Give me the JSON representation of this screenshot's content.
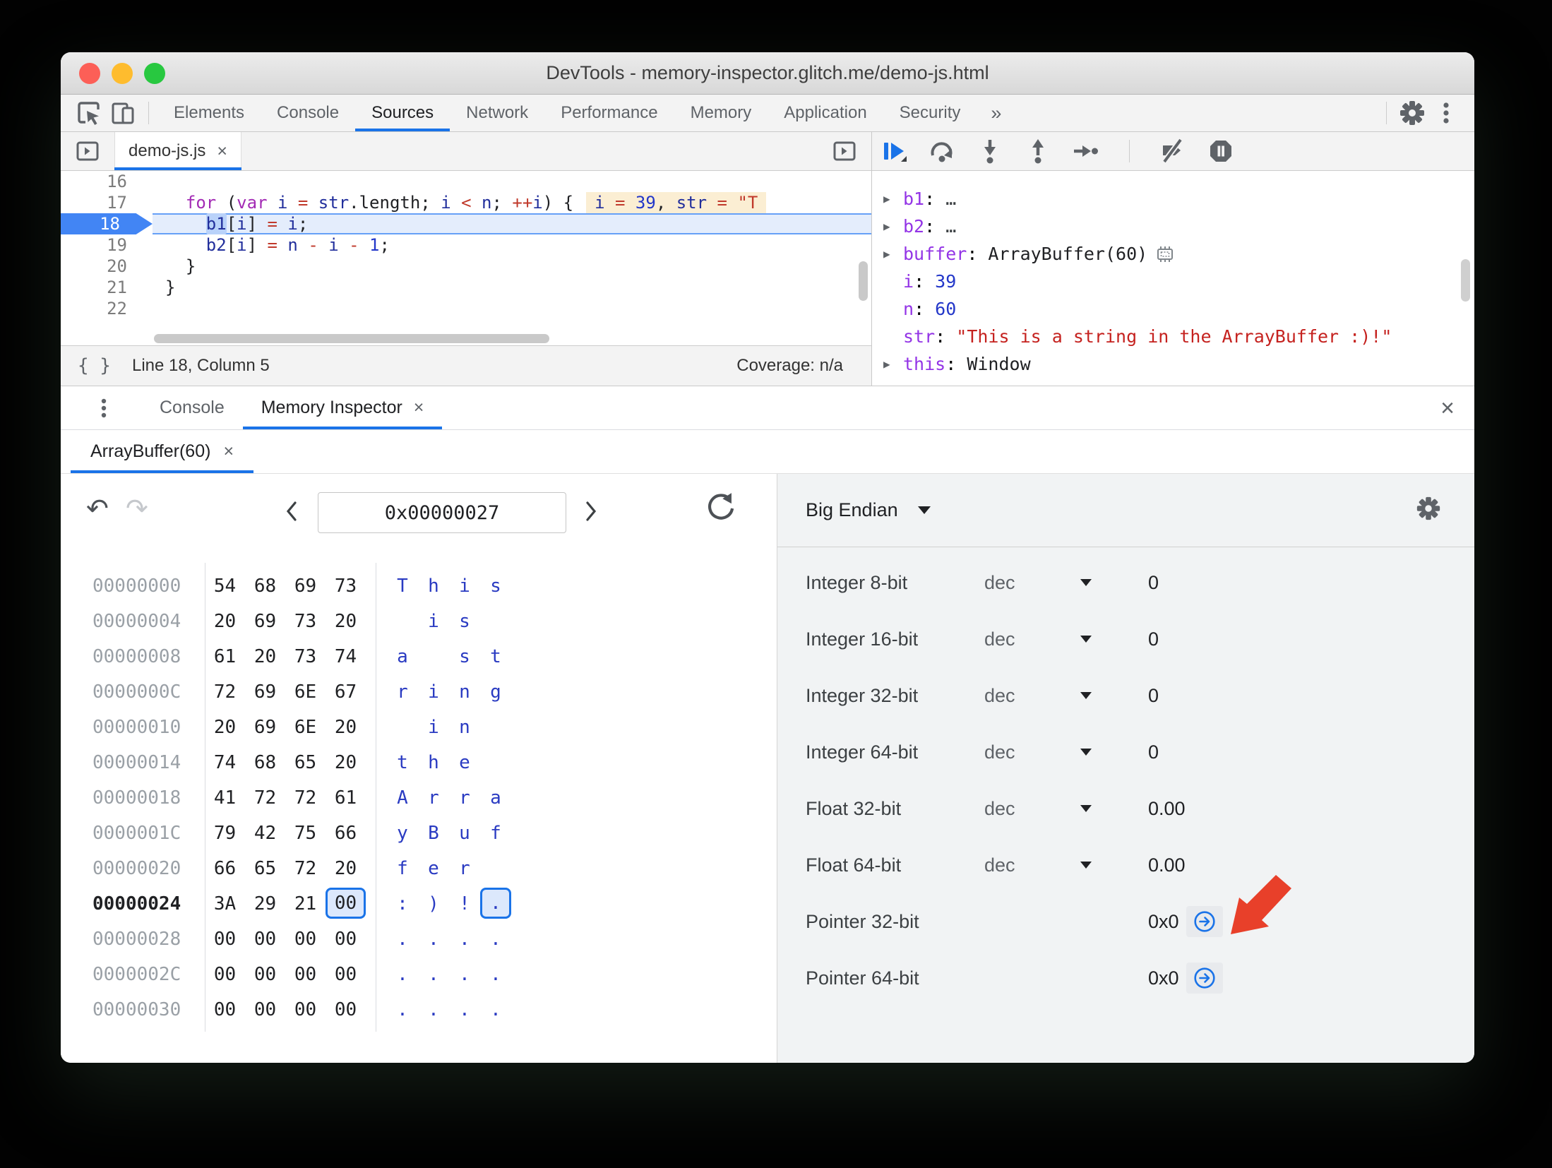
{
  "window": {
    "title": "DevTools - memory-inspector.glitch.me/demo-js.html"
  },
  "toolbar": {
    "tabs": [
      "Elements",
      "Console",
      "Sources",
      "Network",
      "Performance",
      "Memory",
      "Application",
      "Security"
    ],
    "active_tab": "Sources",
    "overflow": "»"
  },
  "sources": {
    "file_tab": {
      "label": "demo-js.js",
      "close": "×"
    },
    "code": {
      "lines": [
        {
          "num": "16",
          "tokens": []
        },
        {
          "num": "17",
          "tokens": [
            [
              "pl",
              "  "
            ],
            [
              "kw",
              "for"
            ],
            [
              "pl",
              " ("
            ],
            [
              "kw",
              "var"
            ],
            [
              "pl",
              " "
            ],
            [
              "v",
              "i"
            ],
            [
              "pl",
              " "
            ],
            [
              "op",
              "="
            ],
            [
              "pl",
              " "
            ],
            [
              "v",
              "str"
            ],
            [
              "pl",
              ".length; "
            ],
            [
              "v",
              "i"
            ],
            [
              "pl",
              " "
            ],
            [
              "op",
              "<"
            ],
            [
              "pl",
              " "
            ],
            [
              "v",
              "n"
            ],
            [
              "pl",
              "; "
            ],
            [
              "op",
              "++"
            ],
            [
              "v",
              "i"
            ],
            [
              "pl",
              ") {"
            ]
          ],
          "eval": [
            [
              "v",
              "i"
            ],
            [
              "pl",
              " "
            ],
            [
              "op",
              "="
            ],
            [
              "pl",
              " "
            ],
            [
              "num",
              "39"
            ],
            [
              "pl",
              ", "
            ],
            [
              "v",
              "str"
            ],
            [
              "pl",
              " "
            ],
            [
              "op",
              "="
            ],
            [
              "pl",
              " "
            ],
            [
              "str",
              "\"T"
            ]
          ]
        },
        {
          "num": "18",
          "exec": true,
          "tokens": [
            [
              "pl",
              "    "
            ],
            [
              "vh",
              "b1"
            ],
            [
              "pl",
              "["
            ],
            [
              "v",
              "i"
            ],
            [
              "pl",
              "] "
            ],
            [
              "op",
              "="
            ],
            [
              "pl",
              " "
            ],
            [
              "v",
              "i"
            ],
            [
              "pl",
              ";"
            ]
          ]
        },
        {
          "num": "19",
          "tokens": [
            [
              "pl",
              "    "
            ],
            [
              "v",
              "b2"
            ],
            [
              "pl",
              "["
            ],
            [
              "v",
              "i"
            ],
            [
              "pl",
              "] "
            ],
            [
              "op",
              "="
            ],
            [
              "pl",
              " "
            ],
            [
              "v",
              "n"
            ],
            [
              "pl",
              " "
            ],
            [
              "op",
              "-"
            ],
            [
              "pl",
              " "
            ],
            [
              "v",
              "i"
            ],
            [
              "pl",
              " "
            ],
            [
              "op",
              "-"
            ],
            [
              "pl",
              " "
            ],
            [
              "num",
              "1"
            ],
            [
              "pl",
              ";"
            ]
          ]
        },
        {
          "num": "20",
          "tokens": [
            [
              "pl",
              "  }"
            ]
          ]
        },
        {
          "num": "21",
          "tokens": [
            [
              "pl",
              "}"
            ]
          ]
        },
        {
          "num": "22",
          "tokens": []
        }
      ]
    }
  },
  "status": {
    "braces": "{ }",
    "position": "Line 18, Column 5",
    "coverage": "Coverage: n/a"
  },
  "debugger": {
    "scope": [
      {
        "expand": true,
        "name": "b1",
        "value": "…",
        "vclass": "dim"
      },
      {
        "expand": true,
        "name": "b2",
        "value": "…",
        "vclass": "dim"
      },
      {
        "expand": true,
        "name": "buffer",
        "value": "ArrayBuffer(60)",
        "vclass": "obj",
        "icon": "memory-chip"
      },
      {
        "expand": false,
        "name": "i",
        "value": "39",
        "vclass": "num"
      },
      {
        "expand": false,
        "name": "n",
        "value": "60",
        "vclass": "num"
      },
      {
        "expand": false,
        "name": "str",
        "value": "\"This is a string in the ArrayBuffer :)!\"",
        "vclass": "str"
      },
      {
        "expand": true,
        "name": "this",
        "value": "Window",
        "vclass": "obj"
      }
    ]
  },
  "drawer": {
    "tabs": [
      {
        "label": "Console",
        "active": false
      },
      {
        "label": "Memory Inspector",
        "active": true,
        "close": "×"
      }
    ],
    "close": "×"
  },
  "memory": {
    "tab": {
      "label": "ArrayBuffer(60)",
      "close": "×"
    },
    "address": "0x00000027",
    "endianness": "Big Endian",
    "hex_rows": [
      {
        "addr": "00000000",
        "bytes": [
          "54",
          "68",
          "69",
          "73"
        ],
        "ascii": [
          "T",
          "h",
          "i",
          "s"
        ]
      },
      {
        "addr": "00000004",
        "bytes": [
          "20",
          "69",
          "73",
          "20"
        ],
        "ascii": [
          " ",
          "i",
          "s",
          " "
        ]
      },
      {
        "addr": "00000008",
        "bytes": [
          "61",
          "20",
          "73",
          "74"
        ],
        "ascii": [
          "a",
          " ",
          "s",
          "t"
        ]
      },
      {
        "addr": "0000000C",
        "bytes": [
          "72",
          "69",
          "6E",
          "67"
        ],
        "ascii": [
          "r",
          "i",
          "n",
          "g"
        ]
      },
      {
        "addr": "00000010",
        "bytes": [
          "20",
          "69",
          "6E",
          "20"
        ],
        "ascii": [
          " ",
          "i",
          "n",
          " "
        ]
      },
      {
        "addr": "00000014",
        "bytes": [
          "74",
          "68",
          "65",
          "20"
        ],
        "ascii": [
          "t",
          "h",
          "e",
          " "
        ]
      },
      {
        "addr": "00000018",
        "bytes": [
          "41",
          "72",
          "72",
          "61"
        ],
        "ascii": [
          "A",
          "r",
          "r",
          "a"
        ]
      },
      {
        "addr": "0000001C",
        "bytes": [
          "79",
          "42",
          "75",
          "66"
        ],
        "ascii": [
          "y",
          "B",
          "u",
          "f"
        ]
      },
      {
        "addr": "00000020",
        "bytes": [
          "66",
          "65",
          "72",
          "20"
        ],
        "ascii": [
          "f",
          "e",
          "r",
          " "
        ]
      },
      {
        "addr": "00000024",
        "bytes": [
          "3A",
          "29",
          "21",
          "00"
        ],
        "ascii": [
          ":",
          ")",
          "!",
          "."
        ],
        "bold": true,
        "selected_index": 3
      },
      {
        "addr": "00000028",
        "bytes": [
          "00",
          "00",
          "00",
          "00"
        ],
        "ascii": [
          ".",
          ".",
          ".",
          "."
        ]
      },
      {
        "addr": "0000002C",
        "bytes": [
          "00",
          "00",
          "00",
          "00"
        ],
        "ascii": [
          ".",
          ".",
          ".",
          "."
        ]
      },
      {
        "addr": "00000030",
        "bytes": [
          "00",
          "00",
          "00",
          "00"
        ],
        "ascii": [
          ".",
          ".",
          ".",
          "."
        ]
      }
    ],
    "interpretations": [
      {
        "label": "Integer 8-bit",
        "format": "dec",
        "value": "0"
      },
      {
        "label": "Integer 16-bit",
        "format": "dec",
        "value": "0"
      },
      {
        "label": "Integer 32-bit",
        "format": "dec",
        "value": "0"
      },
      {
        "label": "Integer 64-bit",
        "format": "dec",
        "value": "0"
      },
      {
        "label": "Float 32-bit",
        "format": "dec",
        "value": "0.00"
      },
      {
        "label": "Float 64-bit",
        "format": "dec",
        "value": "0.00"
      },
      {
        "label": "Pointer 32-bit",
        "format": null,
        "value": "0x0",
        "jump": true
      },
      {
        "label": "Pointer 64-bit",
        "format": null,
        "value": "0x0",
        "jump": true
      }
    ]
  },
  "colors": {
    "accent": "#1a73e8",
    "arrow": "#e8402a",
    "selection_bg": "#dce8fc"
  }
}
